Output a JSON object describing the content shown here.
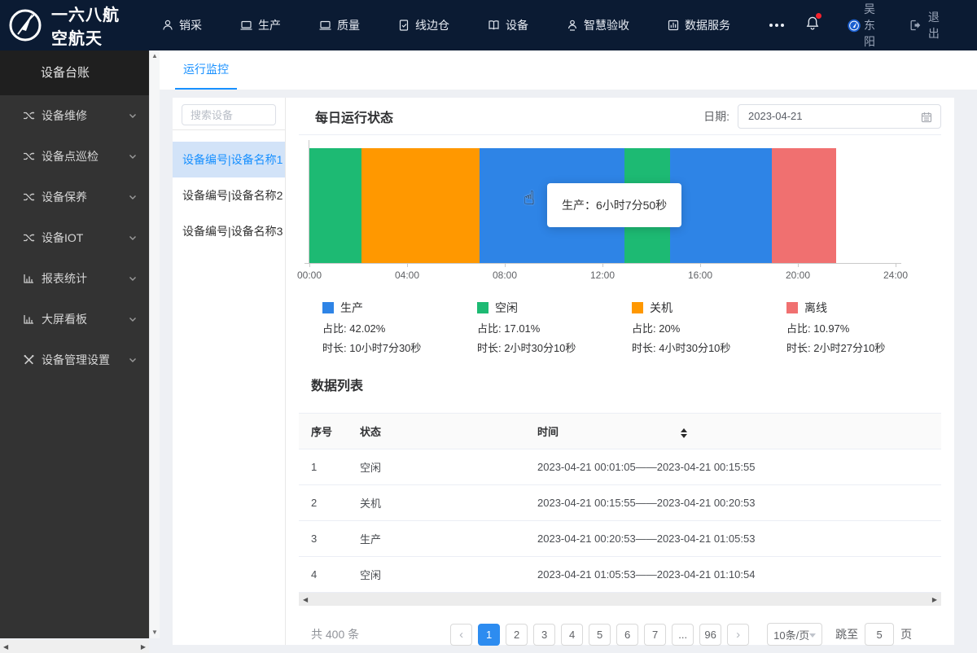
{
  "navbar": {
    "brand": "一六八航空航天",
    "menu": [
      {
        "icon": "person-icon",
        "label": "销采"
      },
      {
        "icon": "laptop-icon",
        "label": "生产"
      },
      {
        "icon": "laptop-icon",
        "label": "质量"
      },
      {
        "icon": "clipboard-icon",
        "label": "线边仓"
      },
      {
        "icon": "book-icon",
        "label": "设备"
      },
      {
        "icon": "person-badge-icon",
        "label": "智慧验收"
      },
      {
        "icon": "histogram-icon",
        "label": "数据服务"
      }
    ],
    "user": "吴东阳",
    "logout": "退出"
  },
  "sidebar": {
    "header": "设备台账",
    "items": [
      {
        "icon": "shuffle-icon",
        "label": "设备维修"
      },
      {
        "icon": "shuffle-icon",
        "label": "设备点巡检"
      },
      {
        "icon": "shuffle-icon",
        "label": "设备保养"
      },
      {
        "icon": "shuffle-icon",
        "label": "设备IOT"
      },
      {
        "icon": "chart-icon",
        "label": "报表统计"
      },
      {
        "icon": "chart-icon",
        "label": "大屏看板"
      },
      {
        "icon": "tools-icon",
        "label": "设备管理设置"
      }
    ]
  },
  "tabs": [
    {
      "label": "运行监控"
    }
  ],
  "device_panel": {
    "search_placeholder": "搜索设备",
    "devices": [
      {
        "label": "设备编号|设备名称1",
        "selected": true
      },
      {
        "label": "设备编号|设备名称2"
      },
      {
        "label": "设备编号|设备名称3"
      }
    ]
  },
  "daily_status": {
    "title": "每日运行状态",
    "date_label": "日期:",
    "date_value": "2023-04-21",
    "tooltip": "生产：6小时7分50秒"
  },
  "chart_data": {
    "type": "bar",
    "title": "每日运行状态",
    "x_ticks": [
      "00:00",
      "04:00",
      "08:00",
      "12:00",
      "16:00",
      "20:00",
      "24:00"
    ],
    "xlim": [
      "00:00",
      "24:00"
    ],
    "segments": [
      {
        "label": "空闲",
        "color": "#1dba73",
        "from": "00:00",
        "to": "02:08",
        "percent": 8.9
      },
      {
        "label": "关机",
        "color": "#ff9800",
        "from": "02:08",
        "to": "06:57",
        "percent": 20.1
      },
      {
        "label": "生产",
        "color": "#2e84e6",
        "from": "06:57",
        "to": "12:53",
        "percent": 24.7
      },
      {
        "label": "空闲",
        "color": "#1dba73",
        "from": "12:53",
        "to": "14:45",
        "percent": 7.8
      },
      {
        "label": "生产",
        "color": "#2e84e6",
        "from": "14:45",
        "to": "18:56",
        "percent": 17.4
      },
      {
        "label": "离线",
        "color": "#f07070",
        "from": "18:56",
        "to": "21:34",
        "percent": 11.0
      }
    ],
    "legend": [
      {
        "name": "生产",
        "color": "#2e84e6",
        "ratio_label": "占比:",
        "ratio": "42.02%",
        "dur_label": "时长:",
        "duration": "10小时7分30秒"
      },
      {
        "name": "空闲",
        "color": "#1dba73",
        "ratio_label": "占比:",
        "ratio": "17.01%",
        "dur_label": "时长:",
        "duration": "2小时30分10秒"
      },
      {
        "name": "关机",
        "color": "#ff9800",
        "ratio_label": "占比:",
        "ratio": "20%",
        "dur_label": "时长:",
        "duration": "4小时30分10秒"
      },
      {
        "name": "离线",
        "color": "#f07070",
        "ratio_label": "占比:",
        "ratio": "10.97%",
        "dur_label": "时长:",
        "duration": "2小时27分10秒"
      }
    ]
  },
  "data_list": {
    "title": "数据列表",
    "columns": [
      "序号",
      "状态",
      "时间"
    ],
    "rows": [
      [
        "1",
        "空闲",
        "2023-04-21 00:01:05——2023-04-21 00:15:55"
      ],
      [
        "2",
        "关机",
        "2023-04-21 00:15:55——2023-04-21 00:20:53"
      ],
      [
        "3",
        "生产",
        "2023-04-21 00:20:53——2023-04-21 01:05:53"
      ],
      [
        "4",
        "空闲",
        "2023-04-21 01:05:53——2023-04-21 01:10:54"
      ]
    ]
  },
  "pagination": {
    "total_text": "共 400 条",
    "pages": [
      {
        "label": "1",
        "active": true
      },
      {
        "label": "2"
      },
      {
        "label": "3"
      },
      {
        "label": "4"
      },
      {
        "label": "5"
      },
      {
        "label": "6"
      },
      {
        "label": "7"
      },
      {
        "label": "..."
      },
      {
        "label": "96"
      }
    ],
    "page_size": "10条/页",
    "jump_label": "跳至",
    "jump_value": "5",
    "jump_suffix": "页"
  }
}
